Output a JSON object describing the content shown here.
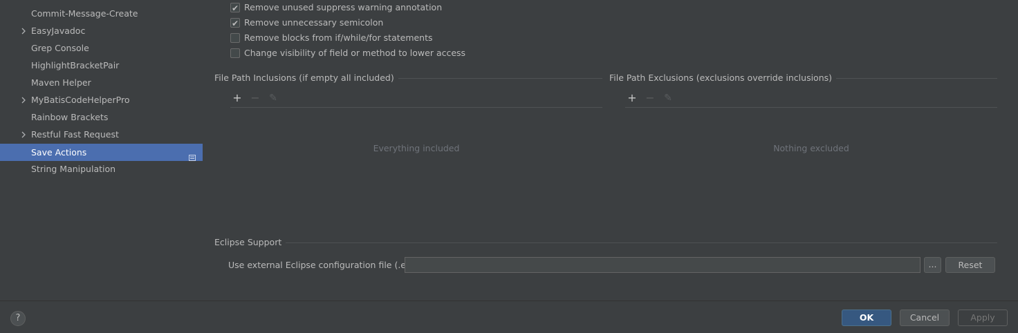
{
  "sidebar": {
    "items": [
      {
        "label": "Commit-Message-Create",
        "expandable": false,
        "selected": false
      },
      {
        "label": "EasyJavadoc",
        "expandable": true,
        "selected": false
      },
      {
        "label": "Grep Console",
        "expandable": false,
        "selected": false
      },
      {
        "label": "HighlightBracketPair",
        "expandable": false,
        "selected": false
      },
      {
        "label": "Maven Helper",
        "expandable": false,
        "selected": false
      },
      {
        "label": "MyBatisCodeHelperPro",
        "expandable": true,
        "selected": false
      },
      {
        "label": "Rainbow Brackets",
        "expandable": false,
        "selected": false
      },
      {
        "label": "Restful Fast Request",
        "expandable": true,
        "selected": false
      },
      {
        "label": "Save Actions",
        "expandable": false,
        "selected": true
      },
      {
        "label": "String Manipulation",
        "expandable": false,
        "selected": false
      }
    ],
    "chevron_glyph": "›"
  },
  "options": [
    {
      "label": "Remove unused suppress warning annotation",
      "checked": true
    },
    {
      "label": "Remove unnecessary semicolon",
      "checked": true
    },
    {
      "label": "Remove blocks from if/while/for statements",
      "checked": false
    },
    {
      "label": "Change visibility of field or method to lower access",
      "checked": false
    }
  ],
  "checkmark": "✔",
  "inclusions": {
    "title": "File Path Inclusions (if empty all included)",
    "empty_text": "Everything included",
    "add": "+",
    "remove": "−",
    "edit": "✎"
  },
  "exclusions": {
    "title": "File Path Exclusions (exclusions override inclusions)",
    "empty_text": "Nothing excluded",
    "add": "+",
    "remove": "−",
    "edit": "✎"
  },
  "eclipse": {
    "title": "Eclipse Support",
    "label": "Use external Eclipse configuration file (.epf)",
    "value": "",
    "browse_label": "...",
    "reset_label": "Reset"
  },
  "footer": {
    "help": "?",
    "ok_label": "OK",
    "cancel_label": "Cancel",
    "apply_label": "Apply"
  },
  "colors": {
    "background": "#3c3f41",
    "selection": "#4b6eaf",
    "ok_button": "#365880"
  }
}
